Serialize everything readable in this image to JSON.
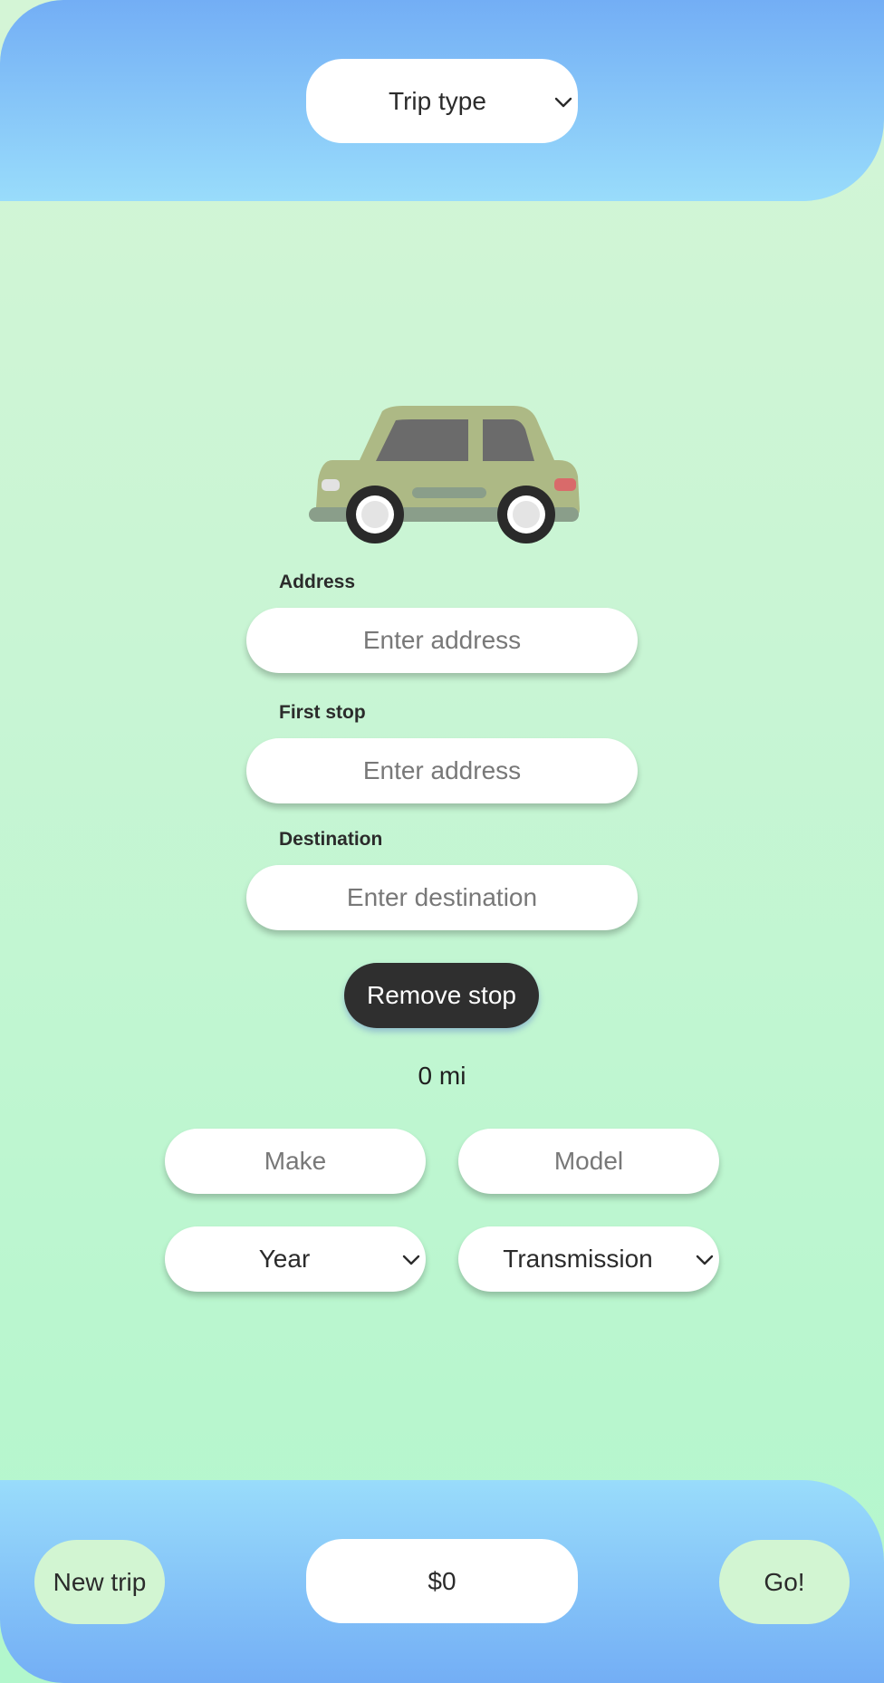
{
  "header": {
    "trip_type_label": "Trip type"
  },
  "form": {
    "address_label": "Address",
    "address_placeholder": "Enter address",
    "first_stop_label": "First stop",
    "first_stop_placeholder": "Enter address",
    "destination_label": "Destination",
    "destination_placeholder": "Enter destination",
    "remove_stop_label": "Remove stop",
    "distance": "0 mi",
    "make_placeholder": "Make",
    "model_placeholder": "Model",
    "year_label": "Year",
    "transmission_label": "Transmission"
  },
  "footer": {
    "new_trip_label": "New trip",
    "price": "$0",
    "go_label": "Go!"
  },
  "colors": {
    "header_gradient_top": "#73aef5",
    "header_gradient_bottom": "#99dcfb",
    "background_top": "#d4f5d6",
    "background_bottom": "#b2f7cc",
    "button_dark": "#2f2f2f",
    "circle_button": "#d2f5d2",
    "car_body": "#adb985"
  },
  "icons": [
    "chevron-down-icon",
    "car-illustration"
  ]
}
